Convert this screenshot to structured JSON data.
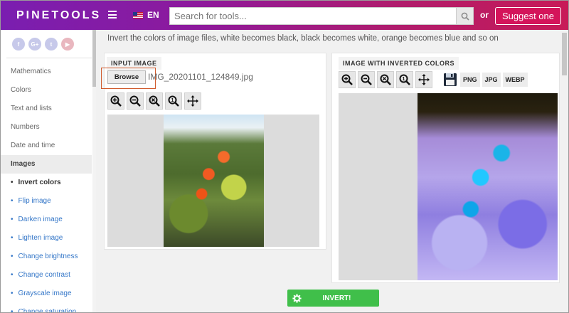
{
  "header": {
    "logo": "PINETOOLS",
    "language": "EN",
    "search_placeholder": "Search for tools...",
    "or_text": "or",
    "suggest_label": "Suggest one"
  },
  "sidebar": {
    "social": [
      "f",
      "G+",
      "t",
      "yt"
    ],
    "items": [
      {
        "label": "Mathematics",
        "type": "category"
      },
      {
        "label": "Colors",
        "type": "category"
      },
      {
        "label": "Text and lists",
        "type": "category"
      },
      {
        "label": "Numbers",
        "type": "category"
      },
      {
        "label": "Date and time",
        "type": "category"
      },
      {
        "label": "Images",
        "type": "category-active"
      },
      {
        "label": "Invert colors",
        "type": "sub-current"
      },
      {
        "label": "Flip image",
        "type": "sub"
      },
      {
        "label": "Darken image",
        "type": "sub"
      },
      {
        "label": "Lighten image",
        "type": "sub"
      },
      {
        "label": "Change brightness",
        "type": "sub"
      },
      {
        "label": "Change contrast",
        "type": "sub"
      },
      {
        "label": "Grayscale image",
        "type": "sub"
      },
      {
        "label": "Change saturation",
        "type": "sub"
      }
    ]
  },
  "main": {
    "description": "Invert the colors of image files, white becomes black, black becomes white, orange becomes blue and so on",
    "input_panel": {
      "title": "INPUT IMAGE",
      "browse_label": "Browse",
      "filename": "IMG_20201101_124849.jpg"
    },
    "output_panel": {
      "title": "IMAGE WITH INVERTED COLORS",
      "formats": [
        "PNG",
        "JPG",
        "WEBP"
      ]
    },
    "invert_label": "INVERT!"
  },
  "colors": {
    "accent": "#d4145a",
    "invert_button": "#40bf4a",
    "link": "#3577c8"
  }
}
